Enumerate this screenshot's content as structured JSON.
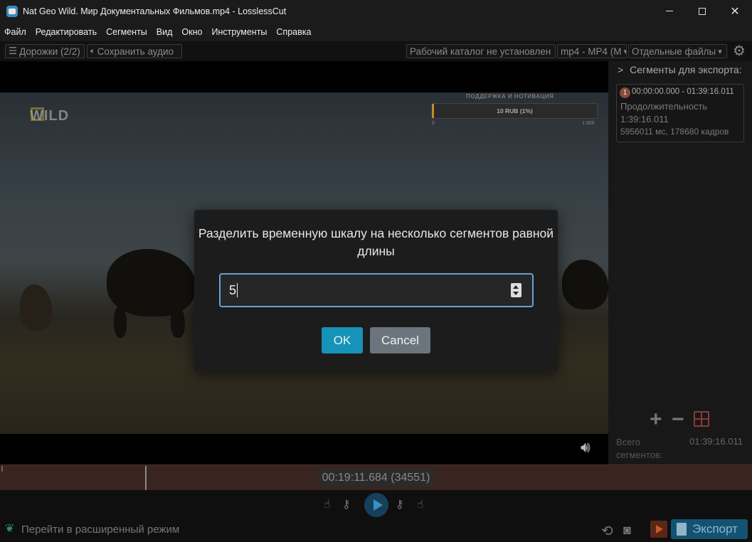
{
  "window": {
    "title": "Nat Geo Wild. Мир Документальных Фильмов.mp4 - LosslessCut",
    "close": "✕"
  },
  "menu": [
    "Файл",
    "Редактировать",
    "Сегменты",
    "Вид",
    "Окно",
    "Инструменты",
    "Справка"
  ],
  "toolbar": {
    "tracks": "Дорожки (2/2)",
    "save_audio": "Сохранить аудио",
    "workdir": "Рабочий каталог не установлен",
    "format": "mp4 - MP4 (M",
    "output_mode": "Отдельные файлы"
  },
  "video_overlay": {
    "title": "ПОДДЕРЖКА И НОТИВАЦИЯ",
    "bar_text": "10 RUB (1%)",
    "progress_fraction": 0.01,
    "min": "0",
    "max": "1 000",
    "channel_logo": "WILD"
  },
  "segments": {
    "header": "Сегменты для экспорта:",
    "items": [
      {
        "number": "1",
        "range": "00:00:00.000 - 01:39:16.011",
        "duration_label": "Продолжительность",
        "duration": "1:39:16.011",
        "details": "5956011 мс, 178680 кадров"
      }
    ],
    "total_label": "Всего сегментов:",
    "total_value": "01:39:16.011"
  },
  "timeline": {
    "time": "00:19:11.684 (34551)"
  },
  "bottom": {
    "advanced_mode": "Перейти в расширенный режим",
    "export": "Экспорт"
  },
  "modal": {
    "title": "Разделить временную шкалу на несколько сегментов равной длины",
    "input_value": "5",
    "ok": "OK",
    "cancel": "Cancel"
  },
  "colors": {
    "accent": "#1693b8",
    "export": "#135372",
    "focus": "#6a9fd8"
  }
}
